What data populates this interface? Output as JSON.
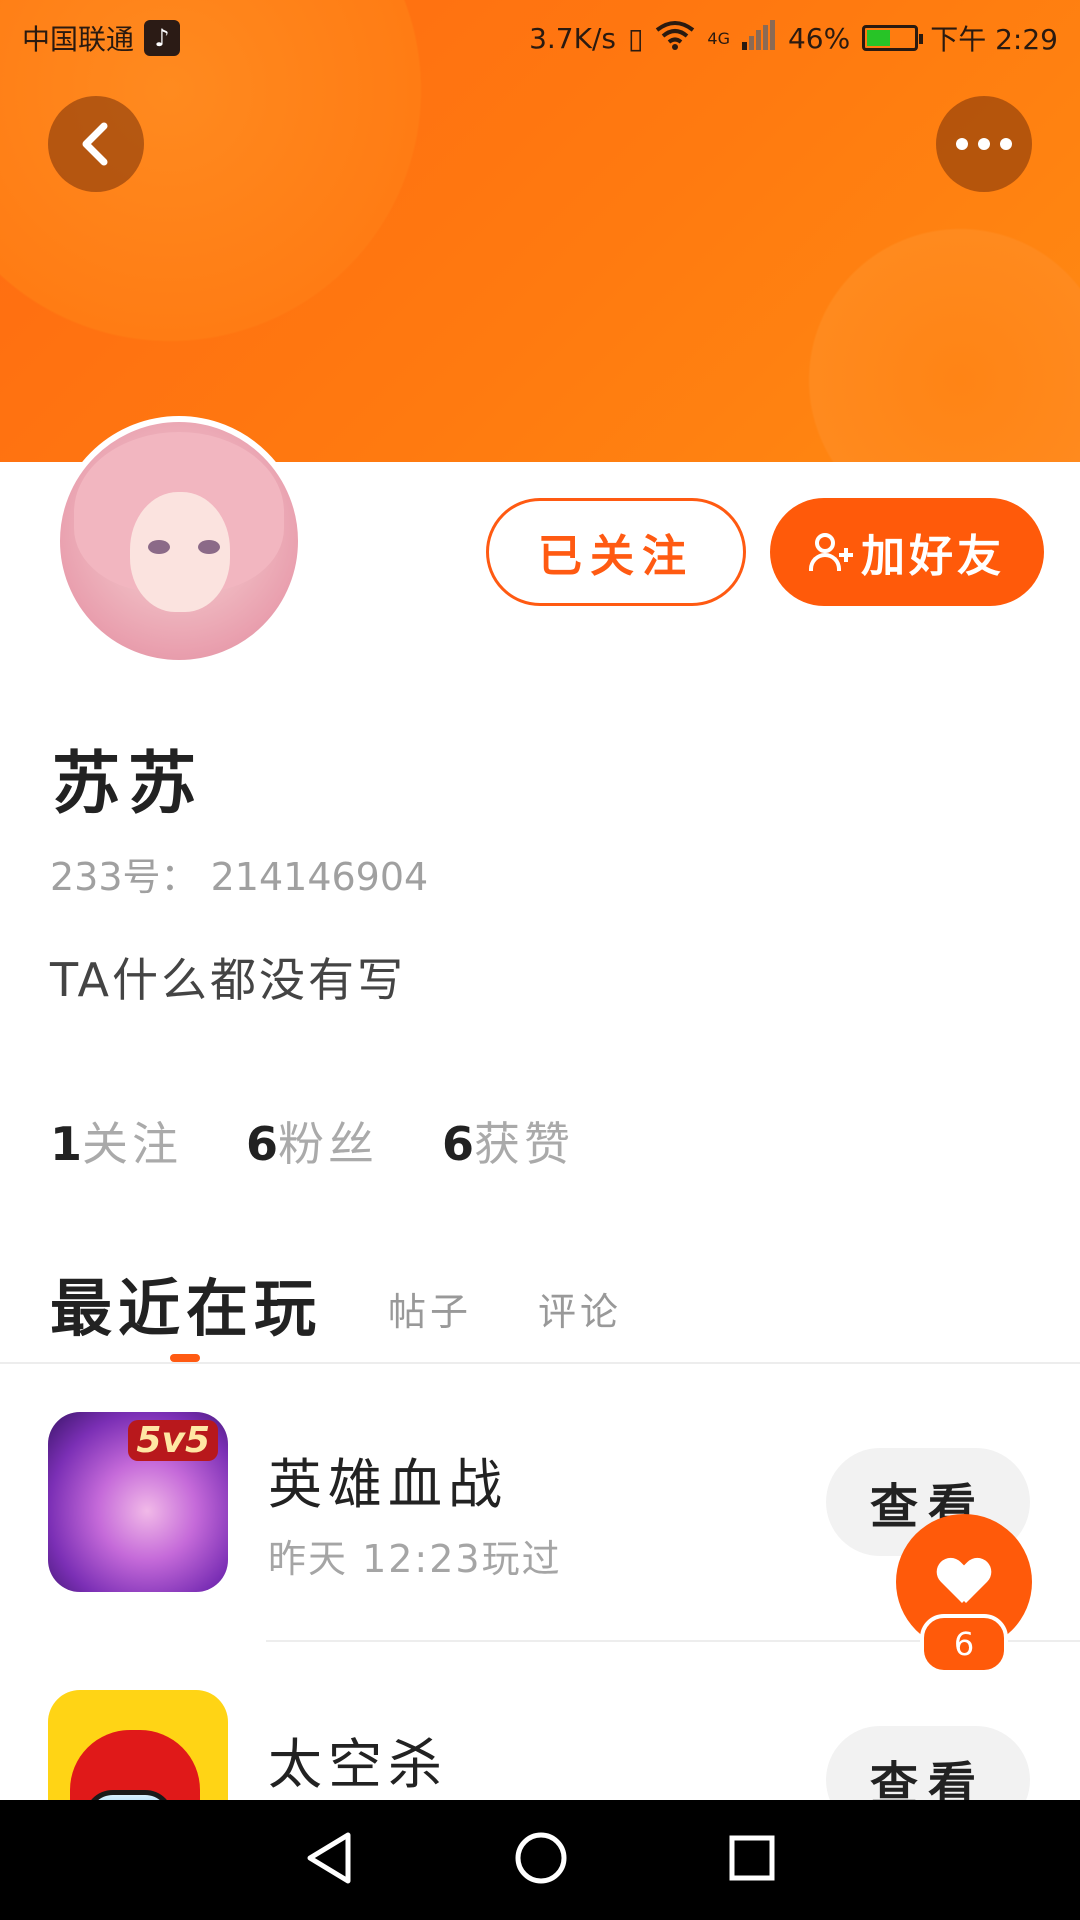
{
  "status_bar": {
    "carrier": "中国联通",
    "net_speed": "3.7K/s",
    "network": "4G",
    "battery": "46%",
    "battery_level": 0.46,
    "time": "下午 2:29"
  },
  "header": {
    "back_icon": "chevron-left-icon",
    "more_icon": "more-horizontal-icon"
  },
  "profile": {
    "name": "苏苏",
    "id_label": "233号：",
    "id_value": "214146904",
    "bio": "TA什么都没有写",
    "followed_label": "已关注",
    "add_friend_label": "加好友"
  },
  "stats": [
    {
      "num": "1",
      "label": "关注"
    },
    {
      "num": "6",
      "label": "粉丝"
    },
    {
      "num": "6",
      "label": "获赞"
    }
  ],
  "tabs": {
    "active": "最近在玩",
    "posts": "帖子",
    "comments": "评论"
  },
  "games": [
    {
      "title": "英雄血战",
      "subtitle": "昨天  12:23玩过",
      "badge": "5v5",
      "view_label": "查看"
    },
    {
      "title": "太空杀",
      "subtitle": "",
      "view_label": "查看"
    }
  ],
  "like": {
    "count": "6"
  },
  "colors": {
    "accent": "#ff5a0a",
    "banner": "#ff7a10"
  }
}
